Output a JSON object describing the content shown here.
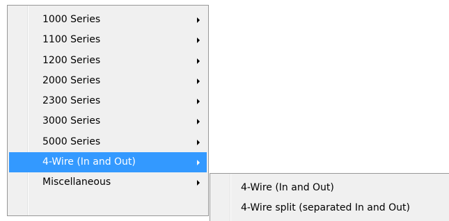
{
  "menu": {
    "items": [
      {
        "label": "1000 Series",
        "has_submenu": true
      },
      {
        "label": "1100 Series",
        "has_submenu": true
      },
      {
        "label": "1200 Series",
        "has_submenu": true
      },
      {
        "label": "2000 Series",
        "has_submenu": true
      },
      {
        "label": "2300 Series",
        "has_submenu": true
      },
      {
        "label": "3000 Series",
        "has_submenu": true
      },
      {
        "label": "5000 Series",
        "has_submenu": true
      },
      {
        "label": "4-Wire (In and Out)",
        "has_submenu": true,
        "highlighted": true
      },
      {
        "label": "Miscellaneous",
        "has_submenu": true
      }
    ]
  },
  "submenu": {
    "items": [
      {
        "label": "4-Wire (In and Out)"
      },
      {
        "label": "4-Wire split (separated In and Out)"
      }
    ]
  },
  "colors": {
    "menu_background": "#f0f0f0",
    "highlight": "#3399ff",
    "border": "#979797",
    "text": "#000000"
  },
  "icons": {
    "submenu_arrow": "triangle-right-icon"
  }
}
